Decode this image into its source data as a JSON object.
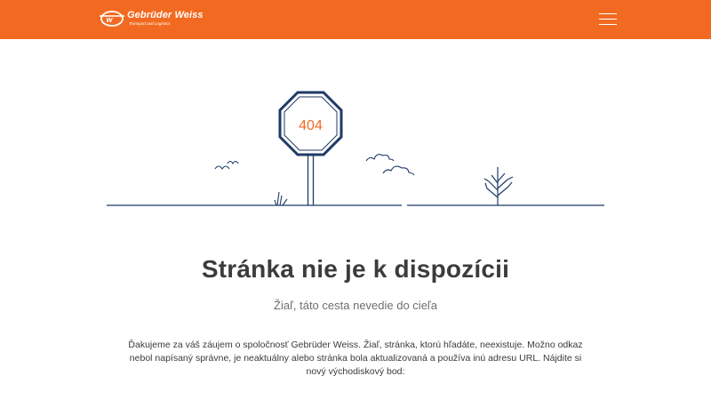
{
  "header": {
    "background_color": "#f26a21",
    "logo": {
      "name": "Gebrüder Weiss",
      "tagline": "Transport and Logistics"
    },
    "menu_icon": "hamburger-menu-icon"
  },
  "illustration": {
    "sign_text": "404",
    "sign_color": "#1f3a66",
    "accent_color": "#f26a21"
  },
  "main": {
    "title": "Stránka nie je k dispozícii",
    "subtitle": "Žiaľ, táto cesta nevedie do cieľa",
    "body": "Ďakujeme za váš záujem o spoločnosť Gebrüder Weiss. Žiaľ, stránka, ktorú hľadáte, neexistuje. Možno odkaz nebol napísaný správne, je neaktuálny alebo stránka bola aktualizovaná a používa inú adresu URL. Nájdite si nový východiskový bod:"
  }
}
